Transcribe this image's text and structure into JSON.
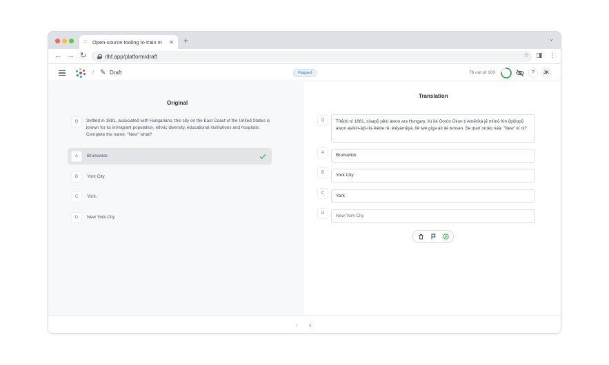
{
  "browser": {
    "tab_title": "Open-source tooling to train m",
    "tab_close": "✕",
    "new_tab": "+",
    "url": "rlhf.app/platform/draft"
  },
  "header": {
    "breadcrumb_sep": "/",
    "page_title": "Draft",
    "status_badge": "Flagged",
    "progress_text": "76 out of 100",
    "progress_fraction": 0.76,
    "help_label": "?",
    "avatar_initials": "JK"
  },
  "original": {
    "title": "Original",
    "question_letter": "Q",
    "question": "Settled in 1681, associated with Hungarians, this city on the East Coast of the United States is known for its immigrant population, ethnic diversity, educational institutions and hospitals. Complete the name: \"New\" what?",
    "options": [
      {
        "letter": "A",
        "label": "Brunswick.",
        "selected": true
      },
      {
        "letter": "B",
        "label": "York City"
      },
      {
        "letter": "C",
        "label": "York."
      },
      {
        "letter": "D",
        "label": "New York City"
      }
    ]
  },
  "translation": {
    "title": "Translation",
    "question_letter": "Q",
    "question": "Títẹ́dó ní 1681, sísẹpọ̀ pẹ̀lú àwọn ara Hungary, ìlú ìlà Oòrùn Òkun ti Amẹ́ríkà jẹ́ mímọ̀ fún ọ̀pọ̀lọpọ̀ àwọn aṣíkiri-àjò-ìlú-ìkède rẹ̀, ẹ̀lẹ́yàmẹ̀yà, ilé iwé gíga àti ilé iwòsàn. Ṣe ìparí orúkọ náà: \"New\" kí ni?",
    "options": [
      {
        "letter": "A",
        "value": "Brunswick"
      },
      {
        "letter": "B",
        "value": "York City"
      },
      {
        "letter": "C",
        "value": "York"
      },
      {
        "letter": "D",
        "value": "New York City"
      }
    ]
  },
  "footer": {
    "prev": "‹",
    "next": "›"
  },
  "colors": {
    "accent_green": "#3fa55b",
    "badge_blue": "#4a6fa5"
  }
}
